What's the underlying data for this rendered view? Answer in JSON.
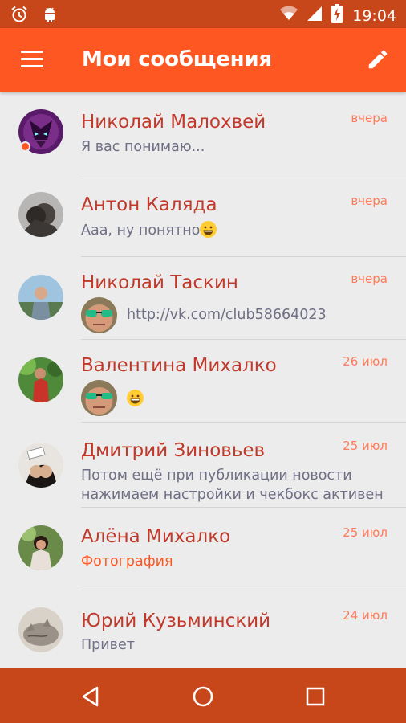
{
  "status_bar": {
    "time": "19:04",
    "left_icons": [
      "alarm-icon",
      "android-debug-icon"
    ],
    "right_icons": [
      "wifi-icon",
      "signal-icon",
      "battery-charging-icon"
    ]
  },
  "app_bar": {
    "title": "Мои сообщения",
    "menu_icon": "hamburger-menu-icon",
    "action_icon": "pencil-edit-icon"
  },
  "conversations": [
    {
      "name": "Николай Малохвей",
      "date": "вчера",
      "preview": "Я вас понимаю...",
      "android_badge": true
    },
    {
      "name": "Антон Каляда",
      "date": "вчера",
      "preview": "Ааа, ну понятно",
      "emoji": true
    },
    {
      "name": "Николай Таскин",
      "date": "вчера",
      "preview": "http://vk.com/club58664023",
      "sender_avatar": true
    },
    {
      "name": "Валентина Михалко",
      "date": "26 июл",
      "preview": "",
      "sender_avatar": true,
      "emoji": true
    },
    {
      "name": "Дмитрий Зиновьев",
      "date": "25 июл",
      "preview_lines": [
        "Потом ещё при публикации новости",
        "нажимаем настройки и чекбокс активен"
      ]
    },
    {
      "name": "Алёна Михалко",
      "date": "25 июл",
      "preview": "Фотография",
      "preview_accent": true
    },
    {
      "name": "Юрий Кузьминский",
      "date": "24 июл",
      "preview": "Привет"
    }
  ],
  "nav_bar": {
    "icons": [
      "back-icon",
      "home-icon",
      "recents-icon"
    ]
  },
  "colors": {
    "primary": "#ff5722",
    "primary_dark": "#c8471a",
    "name_text": "#c0392b",
    "date_text": "#ff7b5a",
    "background": "#ececec"
  }
}
